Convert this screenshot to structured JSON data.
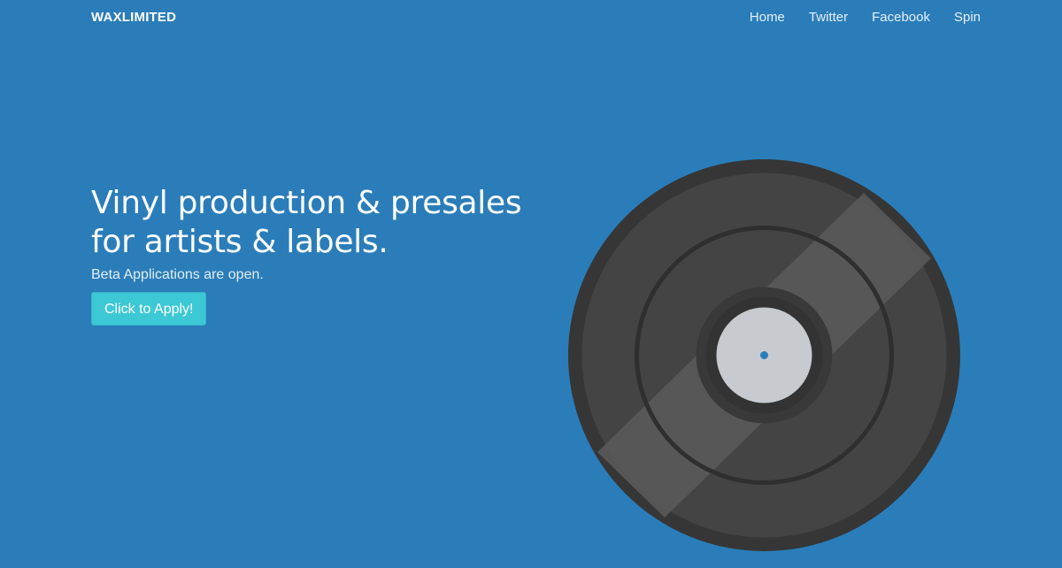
{
  "nav": {
    "brand": "WAXLIMITED",
    "links": [
      {
        "label": "Home"
      },
      {
        "label": "Twitter"
      },
      {
        "label": "Facebook"
      },
      {
        "label": "Spin"
      }
    ]
  },
  "hero": {
    "headline_line1": "Vinyl production & presales",
    "headline_line2": "for artists & labels.",
    "subline": "Beta Applications are open.",
    "cta_label": "Click to Apply!"
  },
  "colors": {
    "background": "#2a7db9",
    "button": "#3cc8d4",
    "record_outer": "#363636",
    "record_body": "#444444",
    "record_label": "#c7cbcf",
    "spindle": "#2a7db9"
  },
  "icons": {
    "record": "vinyl-record-icon"
  }
}
